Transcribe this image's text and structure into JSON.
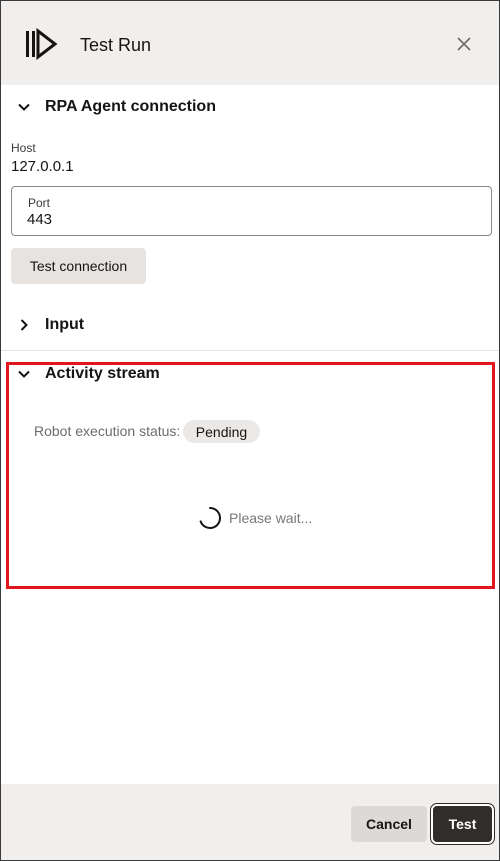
{
  "header": {
    "title": "Test Run",
    "app_icon": "rpa-logo-icon",
    "close_icon": "close-icon"
  },
  "sections": {
    "rpa_agent": {
      "title": "RPA Agent connection",
      "expanded": true,
      "host_label": "Host",
      "host_value": "127.0.0.1",
      "port_label": "Port",
      "port_value": "443",
      "test_connection_label": "Test connection"
    },
    "input": {
      "title": "Input",
      "expanded": false
    },
    "activity_stream": {
      "title": "Activity stream",
      "expanded": true,
      "status_label": "Robot execution status:",
      "status_value": "Pending",
      "wait_text": "Please wait..."
    }
  },
  "footer": {
    "cancel_label": "Cancel",
    "test_label": "Test"
  },
  "colors": {
    "header_bg": "#f1efed",
    "primary_button": "#312d2a",
    "highlight": "#e0161c"
  }
}
